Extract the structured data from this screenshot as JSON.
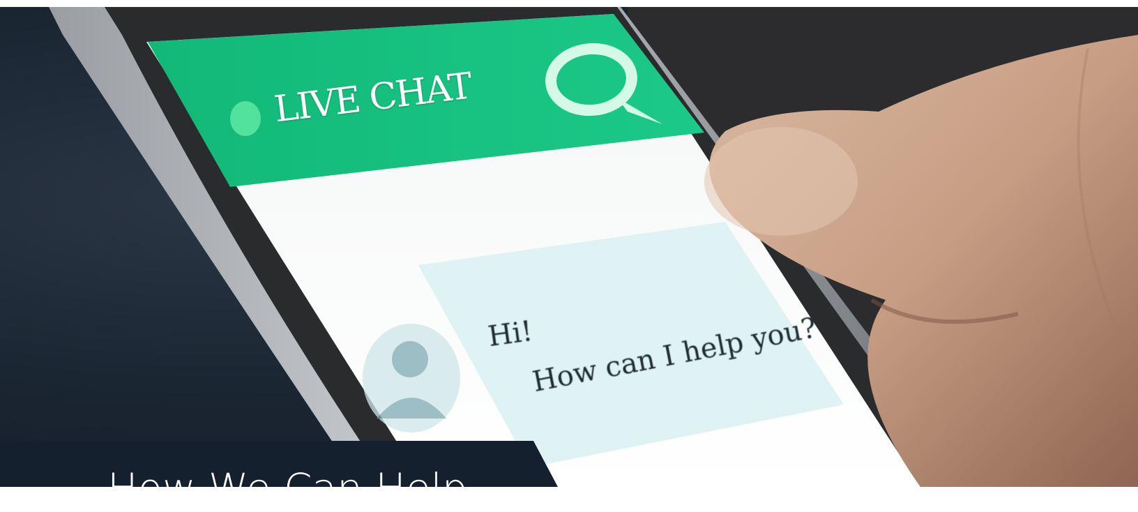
{
  "image": {
    "description_icon": "live-chat-phone-photo",
    "chat_header_label": "LIVE CHAT",
    "message_line_1": "Hi!",
    "message_line_2": "How can I help you?"
  },
  "caption": {
    "title": "How We Can Help"
  },
  "colors": {
    "chat_green": "#19c07e",
    "caption_bg": "#14202e",
    "bubble": "#dff3f5"
  }
}
